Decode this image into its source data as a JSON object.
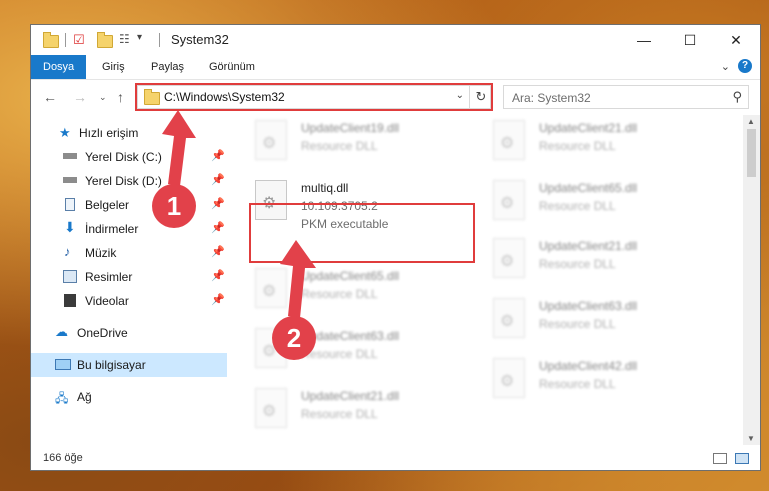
{
  "window": {
    "title": "System32",
    "controls": {
      "minimize": "—",
      "maximize": "☐",
      "close": "✕"
    }
  },
  "ribbon": {
    "tabs": [
      "Dosya",
      "Giriş",
      "Paylaş",
      "Görünüm"
    ]
  },
  "address": {
    "path": "C:\\Windows\\System32",
    "search_placeholder": "Ara: System32"
  },
  "sidebar": {
    "items": [
      {
        "label": "Hızlı erişim",
        "icon": "star-icon"
      },
      {
        "label": "Yerel Disk (C:)",
        "icon": "drive-icon",
        "pinned": true
      },
      {
        "label": "Yerel Disk (D:)",
        "icon": "drive-icon",
        "pinned": true
      },
      {
        "label": "Belgeler",
        "icon": "document-icon",
        "pinned": true
      },
      {
        "label": "İndirmeler",
        "icon": "download-icon",
        "pinned": true
      },
      {
        "label": "Müzik",
        "icon": "music-icon",
        "pinned": true
      },
      {
        "label": "Resimler",
        "icon": "pictures-icon",
        "pinned": true
      },
      {
        "label": "Videolar",
        "icon": "video-icon",
        "pinned": true
      },
      {
        "label": "OneDrive",
        "icon": "cloud-icon"
      },
      {
        "label": "Bu bilgisayar",
        "icon": "computer-icon",
        "selected": true
      },
      {
        "label": "Ağ",
        "icon": "network-icon"
      }
    ]
  },
  "files": {
    "highlighted": {
      "name": "multiq.dll",
      "version": "10.109.3705.2",
      "type": "PKM executable"
    },
    "left_column": [
      {
        "name": "UpdateClient19.dll",
        "type": "Resource DLL"
      },
      {
        "name": "UpdateClient65.dll",
        "type": "Resource DLL"
      },
      {
        "name": "UpdateClient63.dll",
        "type": "Resource DLL"
      },
      {
        "name": "UpdateClient21.dll",
        "type": "Resource DLL"
      }
    ],
    "right_column": [
      {
        "name": "UpdateClient21.dll",
        "type": "Resource DLL"
      },
      {
        "name": "UpdateClient65.dll",
        "type": "Resource DLL"
      },
      {
        "name": "UpdateClient21.dll",
        "type": "Resource DLL"
      },
      {
        "name": "UpdateClient63.dll",
        "type": "Resource DLL"
      },
      {
        "name": "UpdateClient42.dll",
        "type": "Resource DLL"
      }
    ]
  },
  "status": {
    "item_count": "166 öğe"
  },
  "annotations": {
    "marker1": "1",
    "marker2": "2"
  },
  "colors": {
    "accent": "#1979ca",
    "highlight_box": "#e03c3c",
    "marker": "#e2414a",
    "selected": "#cce8ff"
  }
}
